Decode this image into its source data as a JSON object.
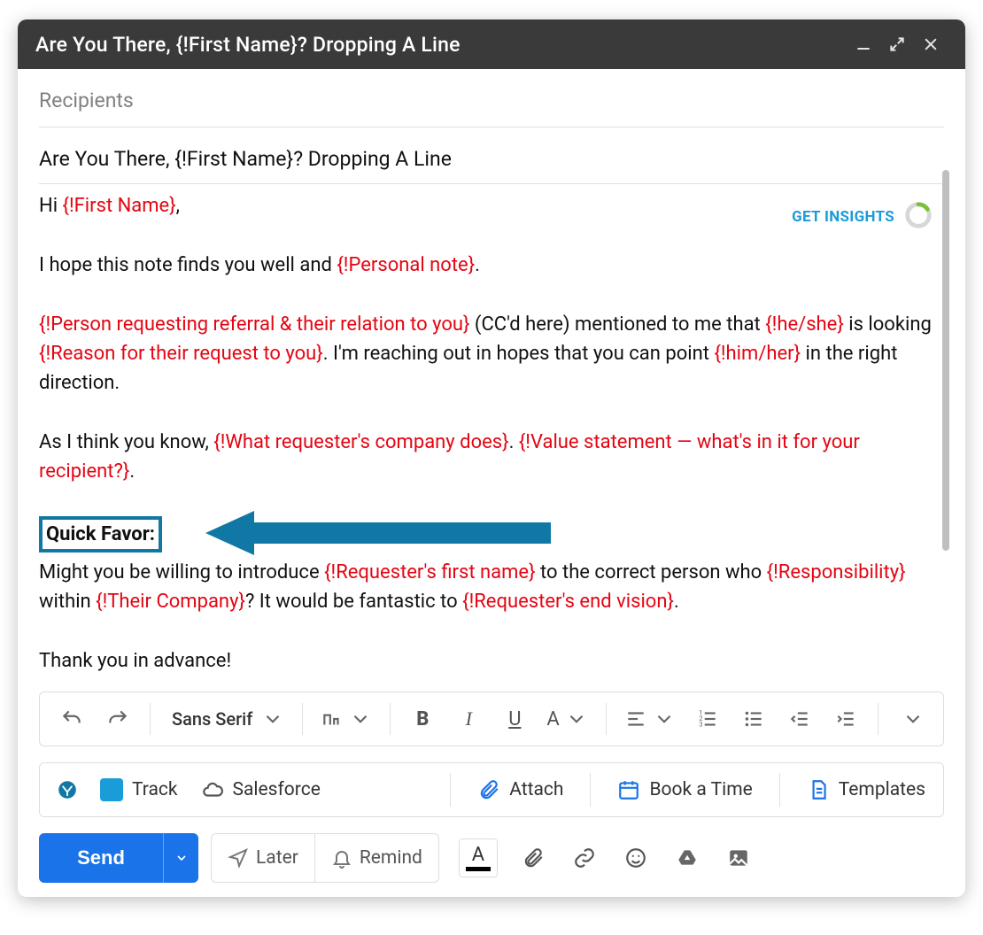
{
  "window": {
    "title": "Are You There, {!First Name}? Dropping A Line"
  },
  "recipients_placeholder": "Recipients",
  "subject": "Are You There, {!First Name}? Dropping A Line",
  "insights": {
    "label": "GET INSIGHTS"
  },
  "body": {
    "greeting_pre": "Hi ",
    "greeting_tok": "{!First Name}",
    "greeting_post": ",",
    "p2_pre": "I hope this note finds you well and ",
    "p2_tok": "{!Personal note}",
    "p2_post": ".",
    "p3_tok1": "{!Person requesting referral & their relation to you}",
    "p3_txt1": " (CC'd here) mentioned to me that ",
    "p3_tok2": "{!he/she}",
    "p3_txt2": " is looking ",
    "p3_tok3": "{!Reason for their request to you}",
    "p3_txt3": ". I'm reaching out in hopes that you can point ",
    "p3_tok4": "{!him/her}",
    "p3_txt4": " in the right direction.",
    "p4_txt1": "As I think you know, ",
    "p4_tok1": "{!What requester's company does}",
    "p4_txt2": ". ",
    "p4_tok2": "{!Value statement — what's in it for your recipient?}",
    "p4_txt3": ".",
    "quick_favor": "Quick Favor:",
    "p5_txt1": "Might you be willing to introduce ",
    "p5_tok1": "{!Requester's first name}",
    "p5_txt2": " to the correct person who ",
    "p5_tok2": "{!Responsibility}",
    "p5_txt3": " within ",
    "p5_tok3": "{!Their Company}",
    "p5_txt4": "? It would be fantastic to ",
    "p5_tok4": "{!Requester's end vision}",
    "p5_txt5": ".",
    "thanks": "Thank you in advance!"
  },
  "toolbar": {
    "font_family": "Sans Serif",
    "bold": "B",
    "italic": "I",
    "underline": "U",
    "textcolor": "A"
  },
  "yesware": {
    "track": "Track",
    "salesforce": "Salesforce",
    "attach": "Attach",
    "book": "Book a Time",
    "templates": "Templates"
  },
  "sendrow": {
    "send": "Send",
    "later": "Later",
    "remind": "Remind",
    "fontcolor": "A"
  }
}
